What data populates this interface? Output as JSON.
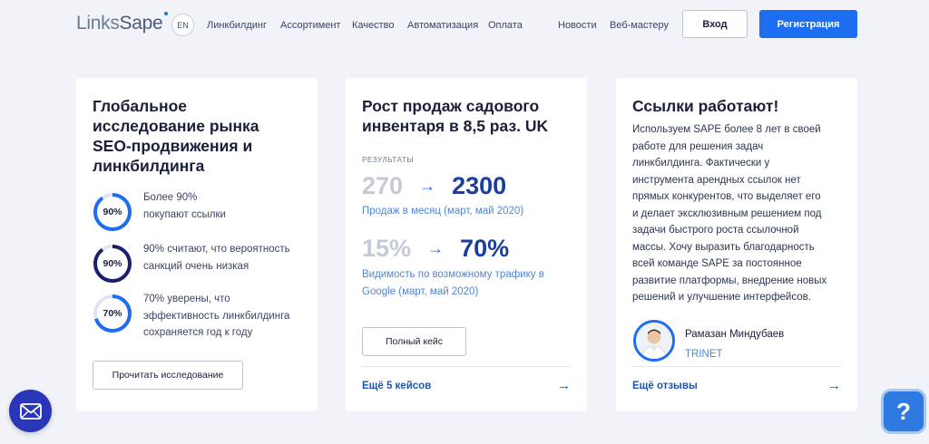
{
  "header": {
    "logo_links": "Links",
    "logo_sape": "Sape",
    "lang": "EN",
    "nav": [
      "Линкбилдинг",
      "Ассортимент",
      "Качество",
      "Автоматизация",
      "Оплата",
      "Новости",
      "Веб-мастеру"
    ],
    "login_label": "Вход",
    "register_label": "Регистрация"
  },
  "card1": {
    "title_lines": [
      "Глобальное",
      "исследование рынка",
      "SEO-продвижения и",
      "линкбилдинга"
    ],
    "stats": [
      {
        "percent": 90,
        "ring_label": "90%",
        "lines": [
          "Более 90%",
          "покупают ссылки"
        ]
      },
      {
        "percent": 90,
        "ring_label": "90%",
        "lines": [
          "90% считают, что вероятность",
          "санкций очень низкая"
        ]
      },
      {
        "percent": 70,
        "ring_label": "70%",
        "lines": [
          "70% уверены, что",
          "эффективность линкбилдинга",
          "сохраняется год к году"
        ]
      }
    ],
    "button_label": "Прочитать исследование"
  },
  "card2": {
    "title_lines": [
      "Рост продаж садового",
      "инвентаря в 8,5 раз. UK"
    ],
    "results_label": "РЕЗУЛЬТАТЫ",
    "metric1": {
      "old": "270",
      "new": "2300",
      "desc_lines": [
        "Продаж в месяц (март, май 2020)"
      ]
    },
    "metric2": {
      "old": "15%",
      "new": "70%",
      "desc_lines": [
        "Видимость по возможному трафику в",
        "Google (март, май 2020)"
      ]
    },
    "button_label": "Полный кейс",
    "footer_link": "Ещё 5 кейсов"
  },
  "card3": {
    "title": "Ссылки работают!",
    "review_lines": [
      "Используем SAPE более 8 лет в своей",
      "работе для решения задач",
      "линкбилдинга. Фактически у",
      "инструмента арендных ссылок нет",
      "прямых конкурентов, что выделяет его",
      "и делает эксклюзивным решением под",
      "задачи быстрого роста ссылочной",
      "массы. Хочу выразить благодарность",
      "всей команде SAPE за постоянное",
      "развитие платформы, внедрение новых",
      "решений и улучшение интерфейсов."
    ],
    "reviewer_name": "Рамазан Миндубаев",
    "reviewer_company": "TRINET",
    "footer_link": "Ещё отзывы"
  },
  "arrow_symbol": "→",
  "help_symbol": "?",
  "colors": {
    "accent": "#1d6df2",
    "dark_ring": "#1b1f6e",
    "link": "#1a55b3",
    "background": "#f1f3f8"
  },
  "icons": [
    "mail-icon",
    "help-icon",
    "arrow-right-icon"
  ]
}
